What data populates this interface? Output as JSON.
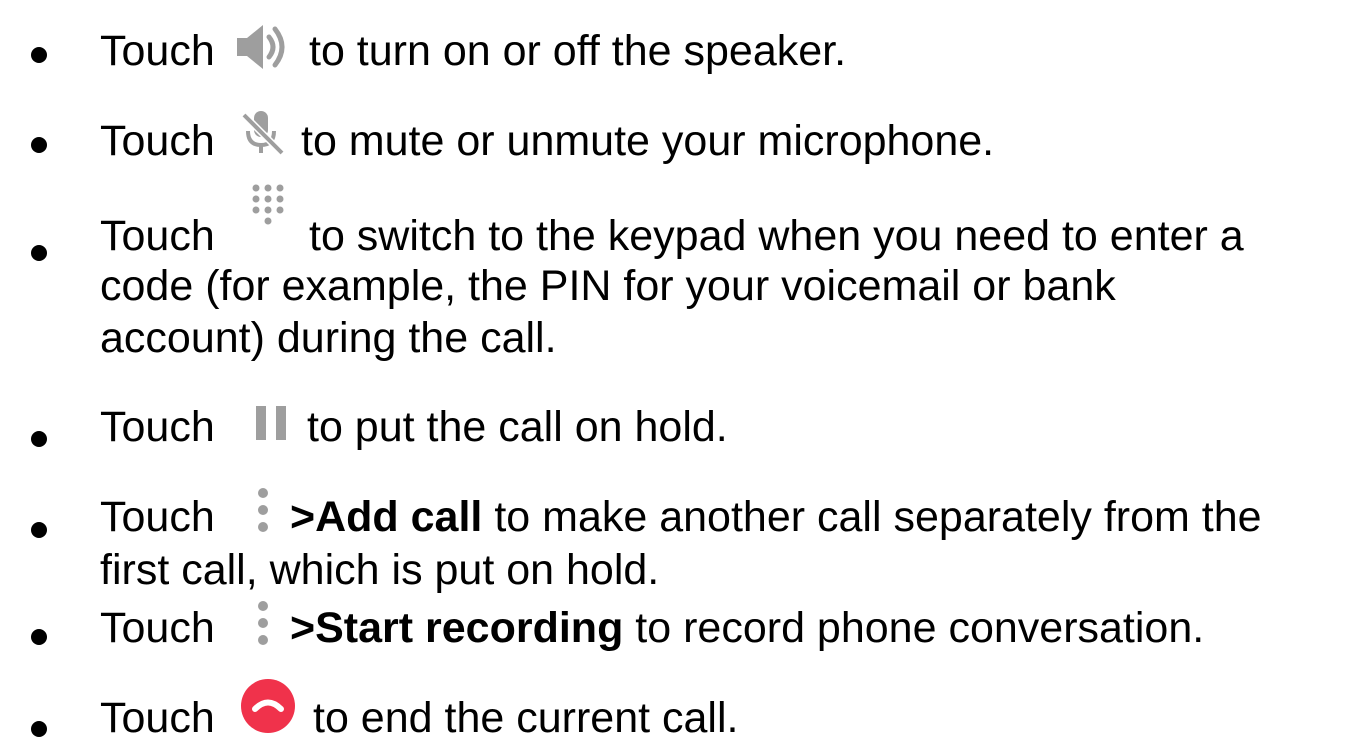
{
  "items": [
    {
      "icon": "speaker-icon",
      "lines": [
        {
          "pre": "Touch",
          "bold": "",
          "post": "to turn on or off the speaker."
        }
      ]
    },
    {
      "icon": "mic-off-icon",
      "lines": [
        {
          "pre": "Touch",
          "bold": "",
          "post": "to mute or unmute your microphone."
        }
      ]
    },
    {
      "icon": "dialpad-icon",
      "lines": [
        {
          "pre": "Touch",
          "bold": "",
          "post": "to switch to the keypad when you need to enter a"
        },
        {
          "text": "code (for example, the PIN for your voicemail or bank"
        },
        {
          "text": "account) during the call."
        }
      ]
    },
    {
      "icon": "pause-icon",
      "lines": [
        {
          "pre": "Touch",
          "bold": "",
          "post": "to put the call on hold."
        }
      ]
    },
    {
      "icon": "more-vert-icon",
      "lines": [
        {
          "pre": "Touch",
          "bold": ">Add call",
          "post": "to make another call separately from the"
        },
        {
          "text": "first call, which is put on hold."
        }
      ]
    },
    {
      "icon": "more-vert-icon",
      "lines": [
        {
          "pre": "Touch",
          "bold": ">Start recording",
          "post": "to record phone conversation."
        }
      ]
    },
    {
      "icon": "end-call-icon",
      "lines": [
        {
          "pre": "Touch",
          "bold": "",
          "post": "to end the current call."
        }
      ]
    }
  ],
  "colors": {
    "text": "#000000",
    "icon_gray": "#9e9e9e",
    "end_call_red": "#f0324b"
  }
}
